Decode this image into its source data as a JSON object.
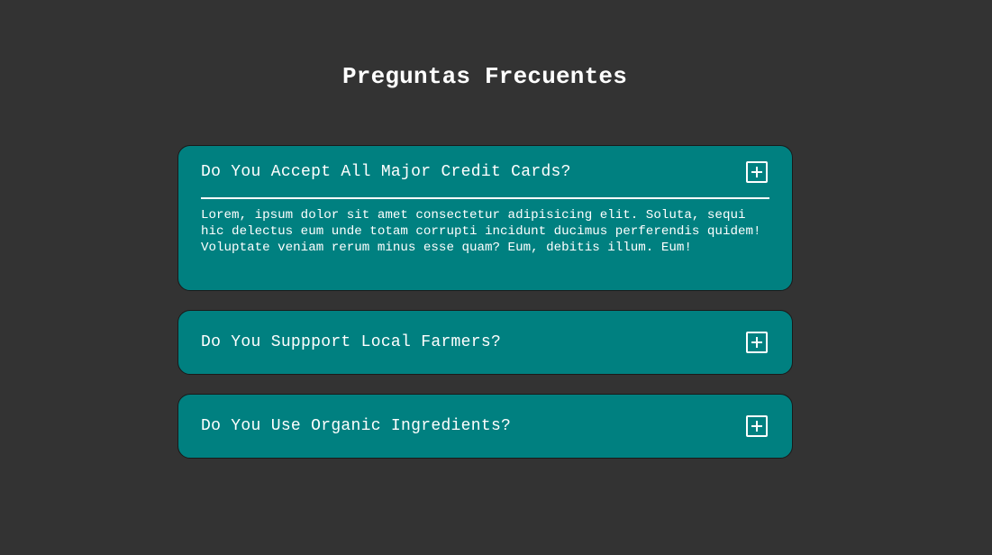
{
  "page": {
    "title": "Preguntas Frecuentes"
  },
  "faq": [
    {
      "question": "Do You Accept All Major Credit Cards?",
      "answer": "Lorem, ipsum dolor sit amet consectetur adipisicing elit. Soluta, sequi hic delectus eum unde totam corrupti incidunt ducimus perferendis quidem! Voluptate veniam rerum minus esse quam? Eum, debitis illum. Eum!",
      "expanded": true,
      "icon": "plus-square-icon"
    },
    {
      "question": "Do You Suppport Local Farmers?",
      "expanded": false,
      "icon": "plus-square-icon"
    },
    {
      "question": "Do You Use Organic Ingredients?",
      "expanded": false,
      "icon": "plus-square-icon"
    }
  ],
  "colors": {
    "background": "#333333",
    "card": "#008080",
    "text": "#ffffff"
  }
}
